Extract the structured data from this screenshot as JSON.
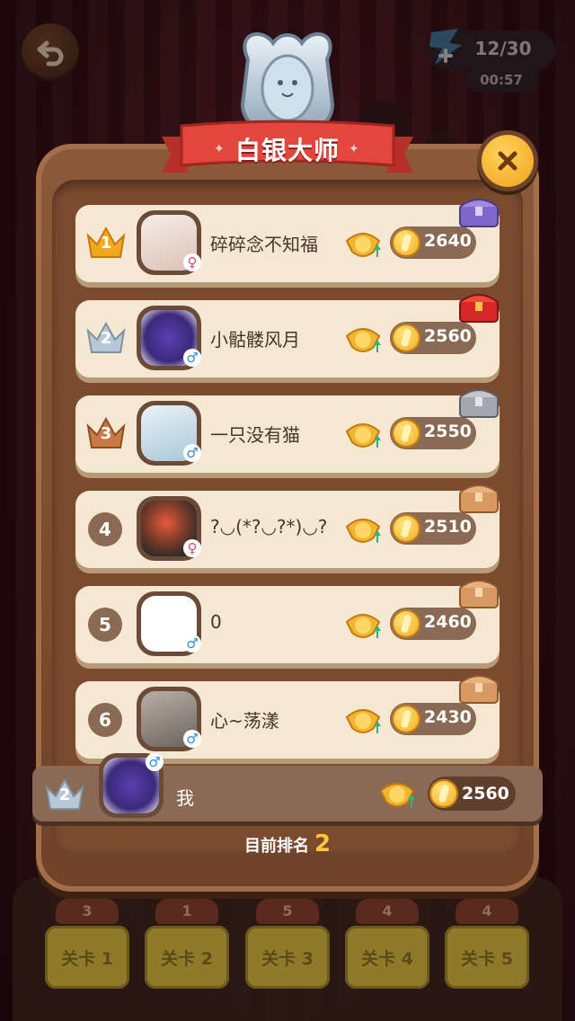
{
  "hud": {
    "energy_count": "12/30",
    "energy_timer": "00:57"
  },
  "panel": {
    "title": "白银大师",
    "current_rank_label": "目前排名",
    "current_rank_value": "2"
  },
  "leaderboard": [
    {
      "rank": "1",
      "rank_style": "gold-crown",
      "name": "碎碎念不知福",
      "gender": "♀",
      "score": "2640",
      "chest": "purple-chest"
    },
    {
      "rank": "2",
      "rank_style": "silver-crown",
      "name": "小骷髅风月",
      "gender": "♂",
      "score": "2560",
      "chest": "red-chest"
    },
    {
      "rank": "3",
      "rank_style": "bronze-crown",
      "name": "一只没有猫",
      "gender": "♂",
      "score": "2550",
      "chest": "silver-chest"
    },
    {
      "rank": "4",
      "rank_style": "circle",
      "name": "?◡(*?◡?*)◡?",
      "gender": "♀",
      "score": "2510",
      "chest": "wood-chest"
    },
    {
      "rank": "5",
      "rank_style": "circle",
      "name": "0",
      "gender": "♂",
      "score": "2460",
      "chest": "wood-chest"
    },
    {
      "rank": "6",
      "rank_style": "circle",
      "name": "心~荡漾",
      "gender": "♂",
      "score": "2430",
      "chest": "wood-chest"
    }
  ],
  "me": {
    "rank": "2",
    "name": "我",
    "gender": "♂",
    "score": "2560"
  },
  "levels": [
    {
      "tag": "3",
      "label": "关卡 1"
    },
    {
      "tag": "1",
      "label": "关卡 2"
    },
    {
      "tag": "5",
      "label": "关卡 3"
    },
    {
      "tag": "4",
      "label": "关卡 4"
    },
    {
      "tag": "4",
      "label": "关卡 5"
    }
  ],
  "colors": {
    "gold_crown": "#f2a81c",
    "silver_crown": "#b9c8d6",
    "bronze_crown": "#c97a45",
    "accent": "#ffc83a"
  }
}
